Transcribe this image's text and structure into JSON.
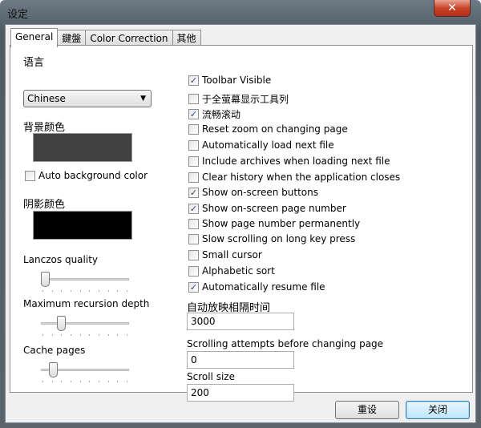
{
  "window": {
    "title": "设定",
    "close_icon": "close-icon"
  },
  "tabs": [
    {
      "label": "General",
      "active": true
    },
    {
      "label": "鍵盤"
    },
    {
      "label": "Color Correction"
    },
    {
      "label": "其他"
    }
  ],
  "left": {
    "language_label": "语言",
    "language_value": "Chinese",
    "bg_color_label": "背景颜色",
    "bg_color": "#404040",
    "auto_bg_label": "Auto background color",
    "auto_bg_checked": false,
    "shadow_color_label": "阴影颜色",
    "shadow_color": "#000000",
    "sliders": [
      {
        "label": "Lanczos quality",
        "value_fraction": 0.0
      },
      {
        "label": "Maximum recursion depth",
        "value_fraction": 0.2
      },
      {
        "label": "Cache pages",
        "value_fraction": 0.1
      }
    ]
  },
  "options": [
    {
      "label": "Toolbar Visible",
      "checked": true
    },
    {
      "label": "于全萤幕显示工具列",
      "checked": false
    },
    {
      "label": "流畅滚动",
      "checked": true
    },
    {
      "label": "Reset zoom on changing page",
      "checked": false
    },
    {
      "label": "Automatically load next file",
      "checked": false
    },
    {
      "label": "Include archives when loading next file",
      "checked": false
    },
    {
      "label": "Clear history when the application closes",
      "checked": false
    },
    {
      "label": "Show on-screen buttons",
      "checked": true
    },
    {
      "label": "Show on-screen page number",
      "checked": true
    },
    {
      "label": "Show page number permanently",
      "checked": false
    },
    {
      "label": "Slow scrolling on long key press",
      "checked": false
    },
    {
      "label": "Small cursor",
      "checked": false
    },
    {
      "label": "Alphabetic sort",
      "checked": false
    },
    {
      "label": "Automatically resume file",
      "checked": true
    }
  ],
  "fields": [
    {
      "label": "自动放映相隔时间",
      "value": "3000"
    },
    {
      "label": "Scrolling attempts before changing page",
      "value": "0"
    },
    {
      "label": "Scroll size",
      "value": "200"
    }
  ],
  "buttons": {
    "reset": "重设",
    "close": "关闭"
  }
}
